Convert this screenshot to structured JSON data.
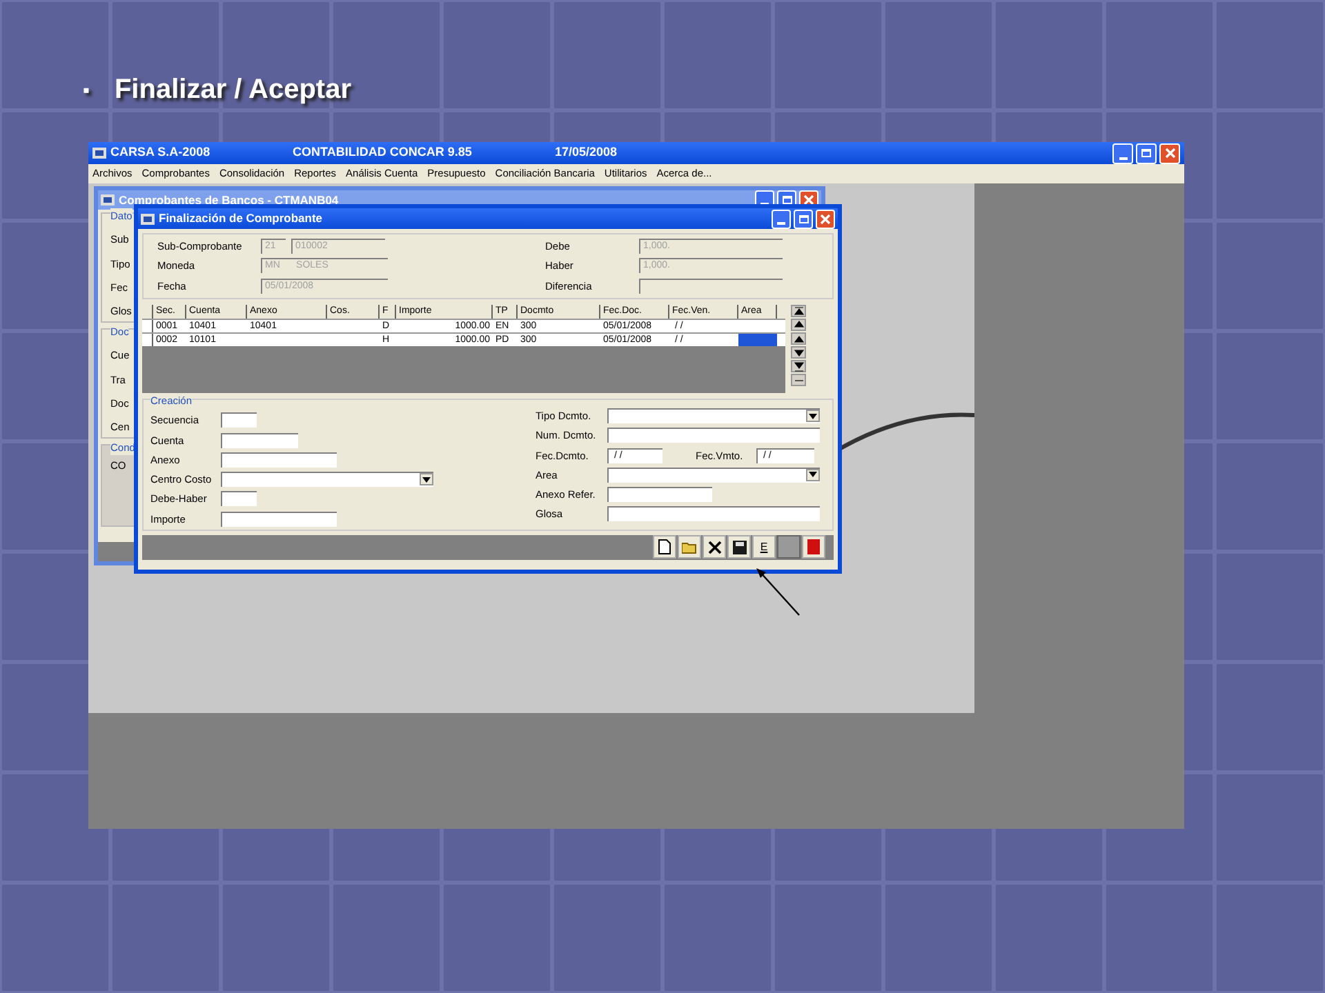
{
  "slide": {
    "bullet": "▪",
    "title": "Finalizar / Aceptar"
  },
  "app": {
    "title": "CARSA S.A-2008",
    "product": "CONTABILIDAD CONCAR 9.85",
    "date": "17/05/2008",
    "menu": [
      "Archivos",
      "Comprobantes",
      "Consolidación",
      "Reportes",
      "Análisis Cuenta",
      "Presupuesto",
      "Conciliación Bancaria",
      "Utilitarios",
      "Acerca de..."
    ]
  },
  "back_window": {
    "title": "Comprobantes de Bancos - CTMANB04",
    "groups": [
      {
        "title": "Dato",
        "labels": [
          "Sub",
          "Tipo",
          "Fec",
          "Glos"
        ]
      },
      {
        "title": "Doc",
        "labels": [
          "Cue",
          "Tra",
          "Doc",
          "Cen"
        ]
      },
      {
        "title": "Cond",
        "labels": [
          "CO"
        ]
      }
    ]
  },
  "dialog": {
    "title": "Finalización de Comprobante",
    "header_left": [
      {
        "label": "Sub-Comprobante",
        "values": [
          "21",
          "010002"
        ]
      },
      {
        "label": "Moneda",
        "values": [
          "MN      SOLES"
        ]
      },
      {
        "label": "Fecha",
        "values": [
          "05/01/2008"
        ]
      }
    ],
    "header_right": [
      {
        "label": "Debe",
        "value": "1,000."
      },
      {
        "label": "Haber",
        "value": "1,000."
      },
      {
        "label": "Diferencia"
      }
    ],
    "table": {
      "columns": [
        "Sec.",
        "Cuenta",
        "Anexo",
        "Cos.",
        "F",
        "Importe",
        "TP",
        "Docmto",
        "Fec.Doc.",
        "Fec.Ven.",
        "Area"
      ],
      "rows": [
        {
          "selected": false,
          "cells": [
            "0001",
            "10401",
            "10401",
            "",
            "D",
            "1000.00",
            "EN",
            "300",
            "05/01/2008",
            " / /",
            ""
          ]
        },
        {
          "selected": true,
          "cells": [
            "0002",
            "10101",
            "",
            "",
            "H",
            "1000.00",
            "PD",
            "300",
            "05/01/2008",
            " / /",
            ""
          ]
        }
      ]
    },
    "creation": {
      "title": "Creación",
      "left": [
        {
          "label": "Secuencia",
          "kind": "text"
        },
        {
          "label": "Cuenta",
          "kind": "text"
        },
        {
          "label": "Anexo",
          "kind": "text"
        },
        {
          "label": "Centro Costo",
          "kind": "combo"
        },
        {
          "label": "Debe-Haber",
          "kind": "text"
        },
        {
          "label": "Importe",
          "kind": "text"
        }
      ],
      "right": [
        {
          "label": "Tipo Dcmto.",
          "kind": "combo"
        },
        {
          "label": "Num. Dcmto.",
          "kind": "text"
        },
        {
          "label": "Fec.Dcmto.",
          "kind": "date",
          "value": " / /",
          "second_label": "Fec.Vmto.",
          "second_value": " / /"
        },
        {
          "label": "Area",
          "kind": "combo"
        },
        {
          "label": "Anexo Refer.",
          "kind": "text"
        },
        {
          "label": "Glosa",
          "kind": "text"
        }
      ]
    },
    "toolbar": [
      {
        "kind": "new"
      },
      {
        "kind": "open"
      },
      {
        "kind": "delete"
      },
      {
        "kind": "save"
      },
      {
        "kind": "text",
        "label": "E"
      },
      {
        "kind": "blank"
      },
      {
        "kind": "exit"
      }
    ]
  }
}
